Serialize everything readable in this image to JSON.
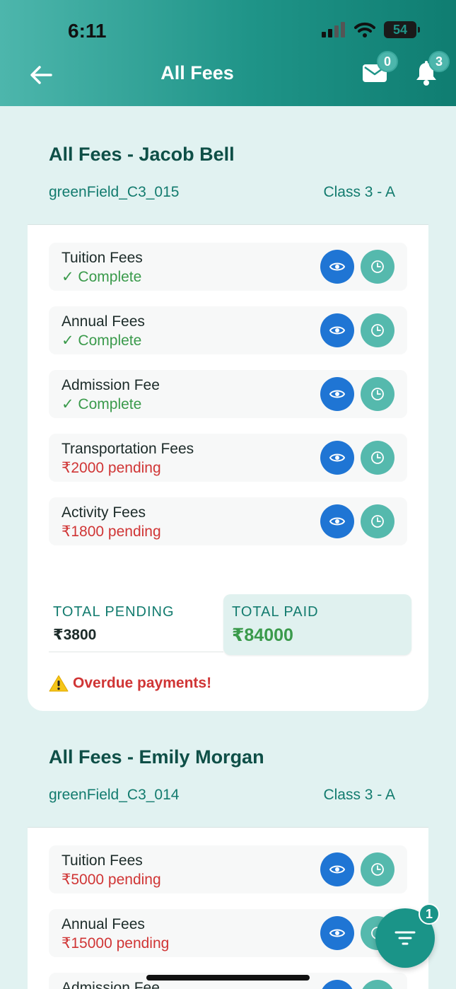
{
  "status_bar": {
    "time": "6:11",
    "battery": "54"
  },
  "header": {
    "title": "All Fees",
    "mail_count": "0",
    "notification_count": "3"
  },
  "students": [
    {
      "title": "All Fees - Jacob Bell",
      "student_id": "greenField_C3_015",
      "class": "Class 3 - A",
      "fees": [
        {
          "name": "Tuition Fees",
          "status": "✓ Complete",
          "state": "complete"
        },
        {
          "name": "Annual Fees",
          "status": "✓ Complete",
          "state": "complete"
        },
        {
          "name": "Admission Fee",
          "status": "✓ Complete",
          "state": "complete"
        },
        {
          "name": "Transportation Fees",
          "status": "₹2000 pending",
          "state": "pending"
        },
        {
          "name": "Activity Fees",
          "status": "₹1800 pending",
          "state": "pending"
        }
      ],
      "total_pending_label": "TOTAL PENDING",
      "total_pending": "₹3800",
      "total_paid_label": "TOTAL PAID",
      "total_paid": "₹84000",
      "alert": "Overdue payments!"
    },
    {
      "title": "All Fees - Emily Morgan",
      "student_id": "greenField_C3_014",
      "class": "Class 3 - A",
      "fees": [
        {
          "name": "Tuition Fees",
          "status": "₹5000 pending",
          "state": "pending"
        },
        {
          "name": "Annual Fees",
          "status": "₹15000 pending",
          "state": "pending"
        },
        {
          "name": "Admission Fee",
          "status": "",
          "state": "pending"
        }
      ]
    }
  ],
  "filter": {
    "badge": "1"
  },
  "colors": {
    "accent": "#1a9488",
    "view_button": "#1f75d4",
    "history_button": "#55b9ad",
    "complete": "#3a9a4b",
    "pending": "#d03535"
  }
}
